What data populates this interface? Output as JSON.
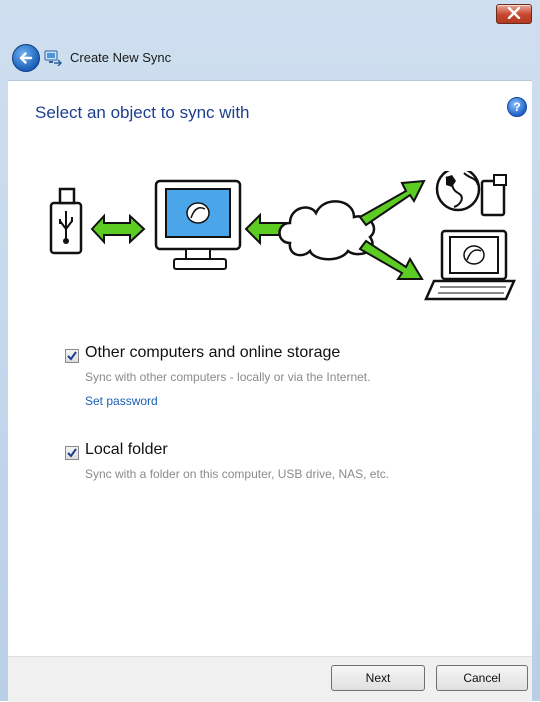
{
  "window": {
    "title": "Create New Sync"
  },
  "page": {
    "heading": "Select an object to sync with"
  },
  "options": [
    {
      "label": "Other computers and online storage",
      "checked": true,
      "description": "Sync with other computers - locally or via the Internet.",
      "link": "Set password"
    },
    {
      "label": "Local folder",
      "checked": true,
      "description": "Sync with a folder on this computer, USB drive, NAS, etc."
    }
  ],
  "footer": {
    "next_label": "Next",
    "cancel_label": "Cancel"
  },
  "icons": {
    "back": "back-arrow-icon",
    "app": "sync-app-icon",
    "help": "help-icon",
    "close": "close-icon",
    "usb": "usb-drive-icon",
    "computer": "computer-icon",
    "cloud": "cloud-icon",
    "globe": "globe-device-icon",
    "laptop": "laptop-icon"
  },
  "colors": {
    "accent": "#1d3f8f",
    "link": "#1a5fb4",
    "arrow": "#5dcc22"
  }
}
